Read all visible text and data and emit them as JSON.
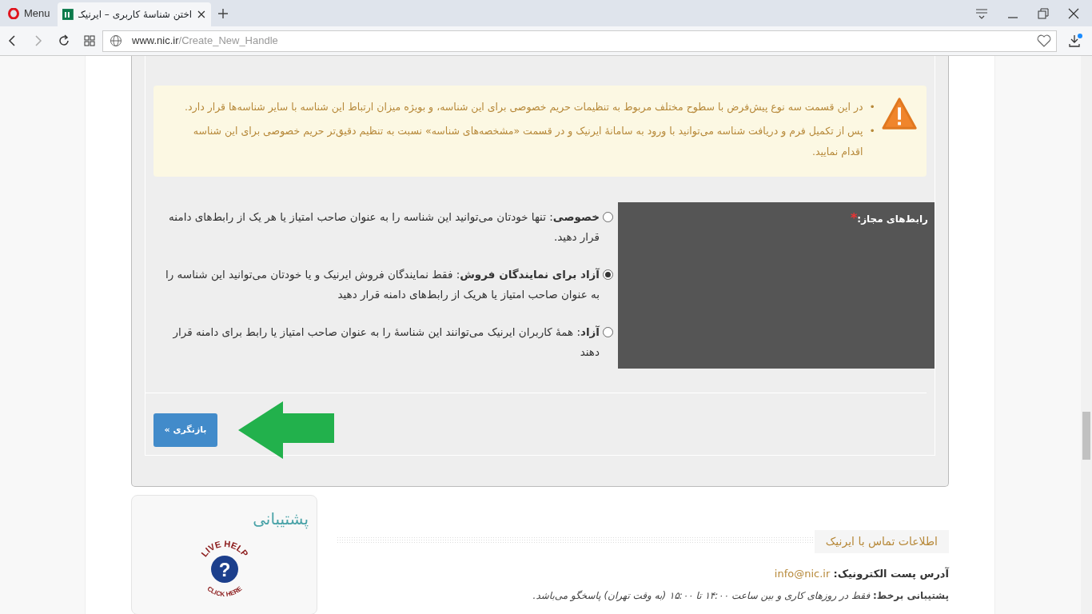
{
  "browser": {
    "menu_label": "Menu",
    "tabs": [
      {
        "label": "اختن شناسهٔ کاربری – ایرنیک",
        "selected": true
      }
    ],
    "address": {
      "host": "www.nic.ir",
      "path": "/Create_New_Handle"
    }
  },
  "notice": {
    "bullet": "•",
    "items": [
      "در این قسمت سه نوع پیش‌فرض با سطوح مختلف مربوط به تنظیمات حریم خصوصی برای این شناسه، و بویژه میزان ارتباط این شناسه با سایر شناسه‌ها قرار دارد.",
      "پس از تکمیل فرم و دریافت شناسه می‌توانید با ورود به سامانهٔ ایرنیک و در قسمت «مشخصه‌های شناسه» نسبت به تنظیم دقیق‌تر حریم خصوصی برای این شناسه اقدام نمایید."
    ]
  },
  "field": {
    "label": "رابط‌های مجاز:",
    "required": true,
    "required_mark": "*",
    "options": [
      {
        "text": "**خصوصی**: تنها خودتان می‌توانید این شناسه را به عنوان صاحب امتیاز یا هر یک از رابط‌های دامنه قرار دهید.",
        "selected": false
      },
      {
        "text": "**آزاد برای نمایندگان فروش**: فقط نمایندگان فروش ایرنیک و یا خودتان می‌توانید این شناسه را به عنوان صاحب امتیاز یا هریک از رابط‌های دامنه قرار دهید",
        "selected": true
      },
      {
        "text": "**آزاد**: همهٔ کاربران ایرنیک می‌توانند این شناسهٔ را به عنوان صاحب امتیاز یا رابط برای دامنه قرار دهند",
        "selected": false
      }
    ]
  },
  "review_button": "بازنگری »",
  "support": {
    "title": "پشتیبانی",
    "logo_top": "LIVE HELP",
    "logo_mark": "?",
    "logo_bottom": "CLICK HERE"
  },
  "contact": {
    "heading": "اطلاعات تماس با ایرنیک",
    "email_label": "آدرس پست الکترونیک:",
    "email": "info@nic.ir",
    "online": "**پشتیبانی برخط:** *فقط در روزهای کاری و بین ساعت ۱۴:۰۰ تا ۱۵:۰۰ (به وقت تهران) پاسخگو می‌باشد.*"
  }
}
